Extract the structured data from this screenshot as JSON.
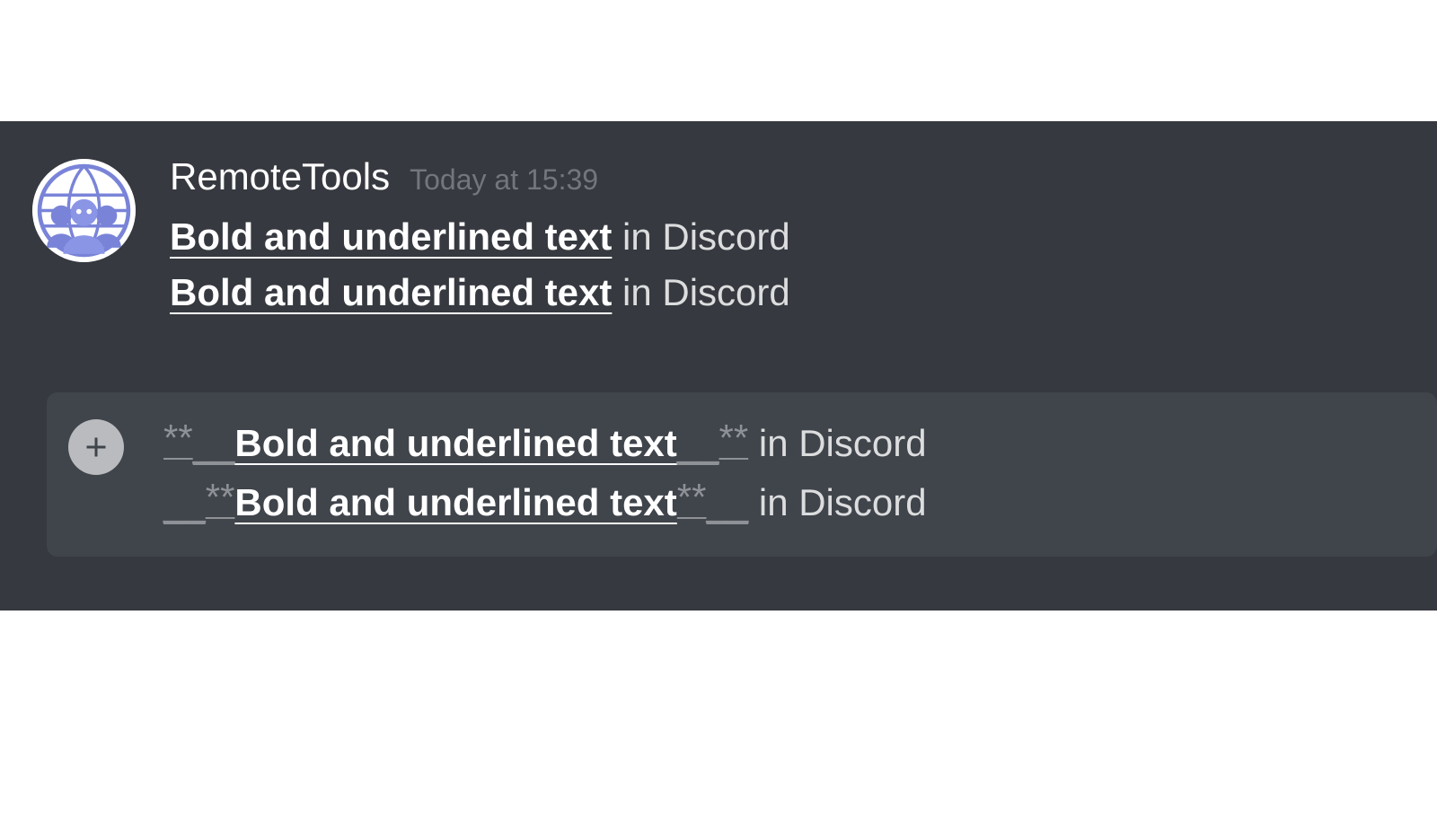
{
  "message": {
    "author": "RemoteTools",
    "timestamp": "Today at 15:39",
    "lines": [
      {
        "bold_underlined": "Bold and underlined text",
        "rest": " in Discord"
      },
      {
        "bold_underlined": "Bold and underlined text",
        "rest": " in Discord"
      }
    ]
  },
  "input": {
    "add_icon": "plus-icon",
    "lines": [
      {
        "open_outer": "**",
        "open_inner": "__",
        "bold_underlined": "Bold and underlined text",
        "close_inner": "__",
        "close_outer": "**",
        "rest": " in Discord"
      },
      {
        "open_outer": "__",
        "open_inner": "**",
        "bold_underlined": "Bold and underlined text",
        "close_inner": "**",
        "close_outer": "__",
        "rest": " in Discord"
      }
    ]
  },
  "colors": {
    "bg": "#36393f",
    "input_bg": "#40444b",
    "text": "#dcddde",
    "muted": "#72767d",
    "syntax": "#8e9297"
  }
}
